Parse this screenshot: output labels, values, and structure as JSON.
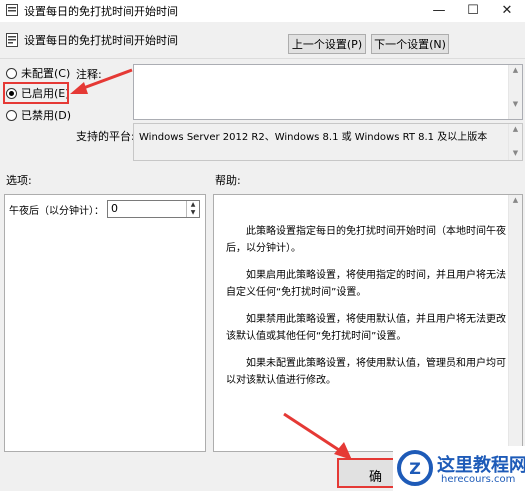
{
  "window": {
    "title": "设置每日的免打扰时间开始时间"
  },
  "header": {
    "title": "设置每日的免打扰时间开始时间",
    "prev_label": "上一个设置(P)",
    "next_label": "下一个设置(N)"
  },
  "state": {
    "options": [
      {
        "label": "未配置(C)",
        "selected": false
      },
      {
        "label": "已启用(E)",
        "selected": true
      },
      {
        "label": "已禁用(D)",
        "selected": false
      }
    ]
  },
  "comment": {
    "label": "注释:",
    "value": ""
  },
  "supported": {
    "label": "支持的平台:",
    "value": "Windows Server 2012 R2、Windows 8.1 或 Windows RT 8.1 及以上版本"
  },
  "options_section": {
    "label": "选项:",
    "field_label": "午夜后（以分钟计）：",
    "field_value": "0"
  },
  "help_section": {
    "label": "帮助:",
    "paragraphs": [
      "此策略设置指定每日的免打扰时间开始时间（本地时间午夜后，以分钟计）。",
      "如果启用此策略设置，将使用指定的时间，并且用户将无法自定义任何“免打扰时间”设置。",
      "如果禁用此策略设置，将使用默认值，并且用户将无法更改该默认值或其他任何“免打扰时间”设置。",
      "如果未配置此策略设置，将使用默认值，管理员和用户均可以对该默认值进行修改。"
    ]
  },
  "footer": {
    "ok_label": "确"
  },
  "watermark": {
    "name": "这里教程网",
    "url": "herecours.com",
    "logo_letter": "Z"
  },
  "colors": {
    "accent_red": "#e53935",
    "watermark_blue": "#1e5bb8"
  }
}
